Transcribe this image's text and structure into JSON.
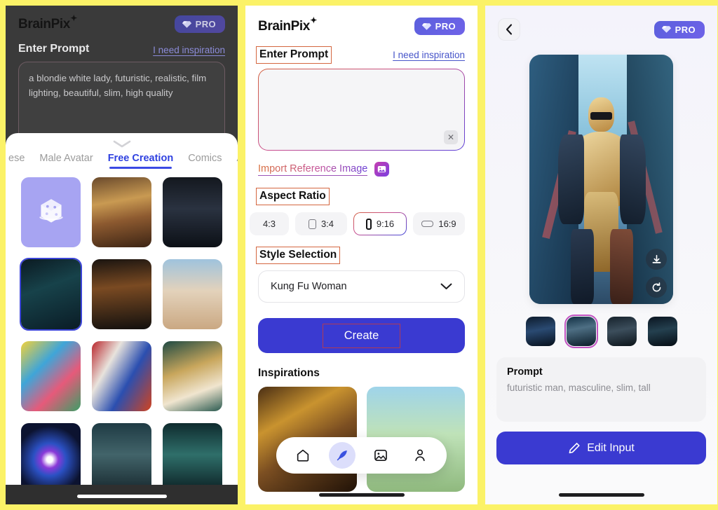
{
  "app": {
    "name": "BrainPix",
    "pro_label": "PRO"
  },
  "panel1": {
    "label_enter_prompt": "Enter Prompt",
    "inspiration_link": "I need inspiration",
    "prompt_value": "a blondie white lady, futuristic, realistic, film lighting, beautiful, slim, high quality",
    "sheet": {
      "tabs": [
        {
          "label": "ese",
          "active": false
        },
        {
          "label": "Male Avatar",
          "active": false
        },
        {
          "label": "Free Creation",
          "active": true
        },
        {
          "label": "Comics",
          "active": false
        },
        {
          "label": "Animatio",
          "active": false
        }
      ],
      "cells": [
        {
          "name": "random-dice",
          "kind": "dice",
          "selected": false
        },
        {
          "name": "vintage-woman-portrait",
          "kind": "art1",
          "selected": false
        },
        {
          "name": "pink-hair-model",
          "kind": "art2",
          "selected": false
        },
        {
          "name": "cyberpunk-woman",
          "kind": "art3",
          "selected": true
        },
        {
          "name": "fire-sorceress",
          "kind": "art4",
          "selected": false
        },
        {
          "name": "steampunk-sky-girl",
          "kind": "art5",
          "selected": false
        },
        {
          "name": "pop-art-bun-girl",
          "kind": "art6",
          "selected": false
        },
        {
          "name": "paint-splash-portrait",
          "kind": "art7",
          "selected": false
        },
        {
          "name": "art-nouveau-lady",
          "kind": "art8",
          "selected": false
        },
        {
          "name": "galaxy-portal-girl",
          "kind": "art9",
          "selected": false
        },
        {
          "name": "moonlight-warrior",
          "kind": "art10",
          "selected": false
        },
        {
          "name": "ice-queen",
          "kind": "art11",
          "selected": false
        }
      ]
    }
  },
  "panel2": {
    "label_enter_prompt": "Enter Prompt",
    "inspiration_link": "I need inspiration",
    "prompt_value": "",
    "clear_icon": "close-icon",
    "import_reference_label": "Import Reference Image",
    "label_aspect_ratio": "Aspect Ratio",
    "aspect_ratios": [
      {
        "label": "4:3",
        "icon": "none",
        "active": false
      },
      {
        "label": "3:4",
        "icon": "portrait-rect-icon",
        "active": false
      },
      {
        "label": "9:16",
        "icon": "tall-rect-icon",
        "active": true
      },
      {
        "label": "16:9",
        "icon": "landscape-rect-icon",
        "active": false
      }
    ],
    "label_style_selection": "Style Selection",
    "style_selected": "Kung Fu Woman",
    "create_label": "Create",
    "inspirations_title": "Inspirations",
    "inspirations": [
      {
        "name": "vintage-film-woman"
      },
      {
        "name": "sakura-blonde-girl"
      }
    ],
    "tabbar": [
      {
        "name": "home-icon",
        "active": false
      },
      {
        "name": "feather-icon",
        "active": true
      },
      {
        "name": "gallery-icon",
        "active": false
      },
      {
        "name": "profile-icon",
        "active": false
      }
    ]
  },
  "panel3": {
    "back_icon": "chevron-left-icon",
    "hero_alt": "futuristic-golden-cyborg-man",
    "hero_actions": [
      {
        "name": "download-icon"
      },
      {
        "name": "regenerate-icon"
      }
    ],
    "thumbnails": [
      {
        "name": "thumb-dark-armor",
        "selected": false
      },
      {
        "name": "thumb-golden-cyborg",
        "selected": true
      },
      {
        "name": "thumb-bald-face",
        "selected": false
      },
      {
        "name": "thumb-white-suit",
        "selected": false
      }
    ],
    "prompt_heading": "Prompt",
    "prompt_text": "futuristic man, masculine, slim, tall",
    "edit_input_label": "Edit Input",
    "edit_icon": "pencil-icon"
  },
  "colors": {
    "page_bg": "#fbf267",
    "accent_blue": "#3a3ad1",
    "highlight_red": "#d4663f",
    "tab_active": "#2f41e0"
  }
}
